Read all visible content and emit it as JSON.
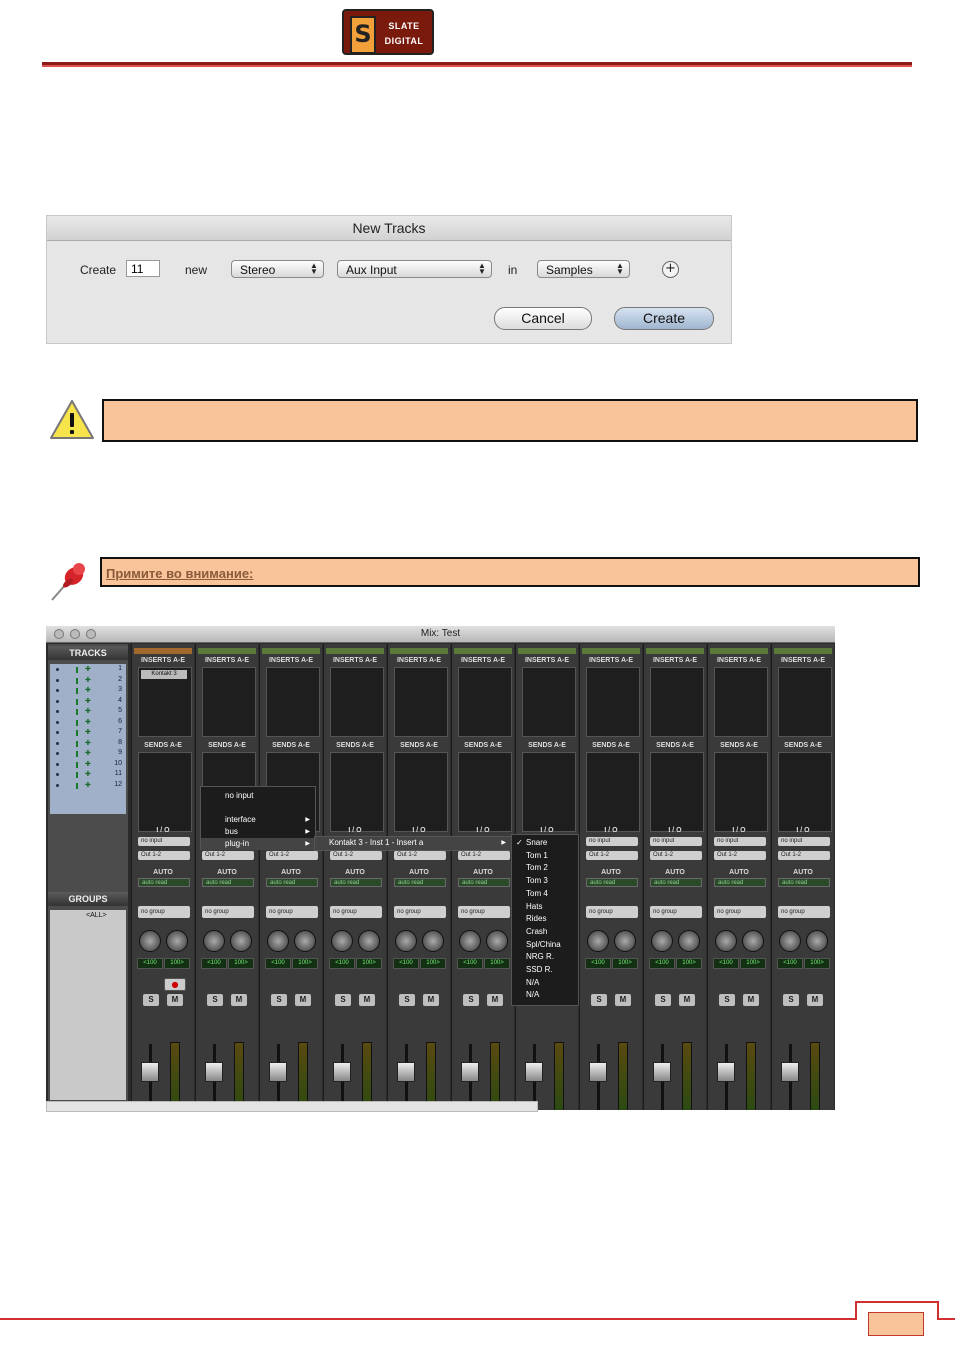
{
  "header": {
    "logo_big": "S",
    "logo_line1": "SLATE",
    "logo_line2": "DIGITAL"
  },
  "new_tracks_dialog": {
    "title": "New Tracks",
    "create_label": "Create",
    "count_value": "11",
    "new_label": "new",
    "format_value": "Stereo",
    "type_value": "Aux Input",
    "in_label": "in",
    "timebase_value": "Samples",
    "cancel_label": "Cancel",
    "create_button_label": "Create"
  },
  "warning_box": {
    "icon": "warning-icon",
    "text": ""
  },
  "note_box": {
    "icon": "pushpin-icon",
    "text": "Примите во внимание:"
  },
  "mixer": {
    "window_title": "Mix: Test",
    "tracks_header": "TRACKS",
    "groups_header": "GROUPS",
    "groups_item": "<ALL>",
    "track_numbers": [
      "1",
      "2",
      "3",
      "4",
      "5",
      "6",
      "7",
      "8",
      "9",
      "10",
      "11",
      "12"
    ],
    "strip_labels": {
      "inserts": "INSERTS A-E",
      "sends": "SENDS A-E",
      "io": "I / O",
      "auto": "AUTO",
      "no_input": "no input",
      "output": "Out 1-2",
      "auto_read": "auto read",
      "no_group": "no group",
      "pan_left": "<100",
      "pan_right": "100>",
      "solo": "S",
      "mute": "M",
      "insert_slot_1": "Kontakt 3"
    },
    "input_menu": {
      "items": [
        "no input",
        "interface",
        "bus",
        "plug-in"
      ]
    },
    "plugin_submenu": {
      "item": "Kontakt 3 - Inst 1 - Insert a"
    },
    "output_names_menu": {
      "items": [
        "Snare",
        "Tom 1",
        "Tom 2",
        "Tom 3",
        "Tom 4",
        "Hats",
        "Rides",
        "Crash",
        "Spl/China",
        "NRG R.",
        "SSD R.",
        "N/A",
        "N/A"
      ]
    }
  },
  "footer": {
    "page_number": ""
  }
}
